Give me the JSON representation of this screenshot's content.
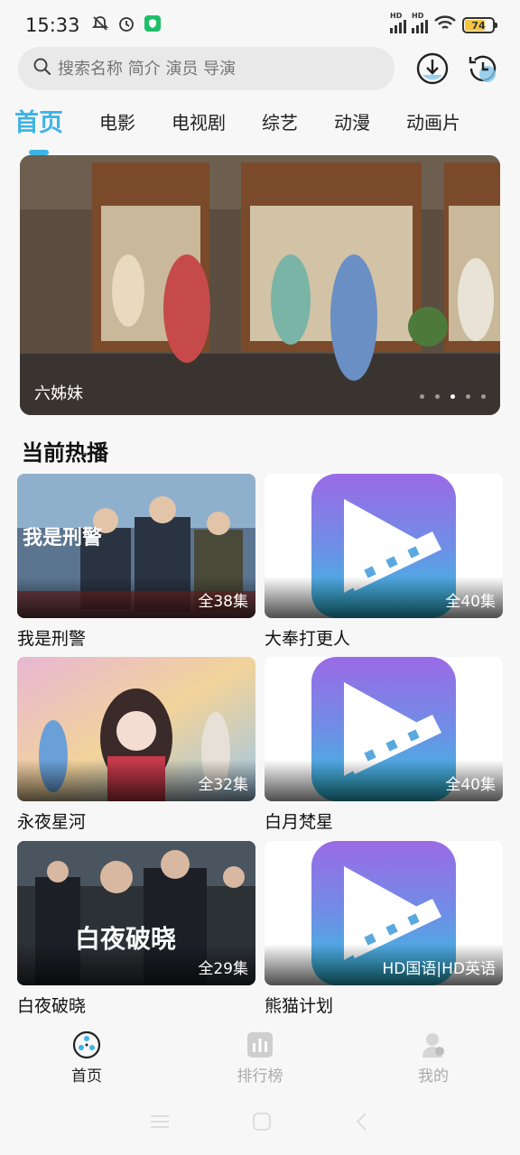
{
  "status": {
    "time": "15:33",
    "battery": "74"
  },
  "search": {
    "placeholder": "搜索名称 简介 演员 导演"
  },
  "tabs": [
    "首页",
    "电影",
    "电视剧",
    "综艺",
    "动漫",
    "动画片"
  ],
  "banner": {
    "caption": "六姊妹"
  },
  "section": {
    "title": "当前热播"
  },
  "cards": [
    {
      "title": "我是刑警",
      "badge": "全38集"
    },
    {
      "title": "大奉打更人",
      "badge": "全40集"
    },
    {
      "title": "永夜星河",
      "badge": "全32集"
    },
    {
      "title": "白月梵星",
      "badge": "全40集"
    },
    {
      "title": "白夜破晓",
      "badge": "全29集"
    },
    {
      "title": "熊猫计划",
      "badge": "HD国语|HD英语"
    }
  ],
  "poster_texts": {
    "police": "我是刑警",
    "night": "白夜破晓"
  },
  "nav": [
    "首页",
    "排行榜",
    "我的"
  ],
  "colors": {
    "accent": "#3db4e6"
  }
}
